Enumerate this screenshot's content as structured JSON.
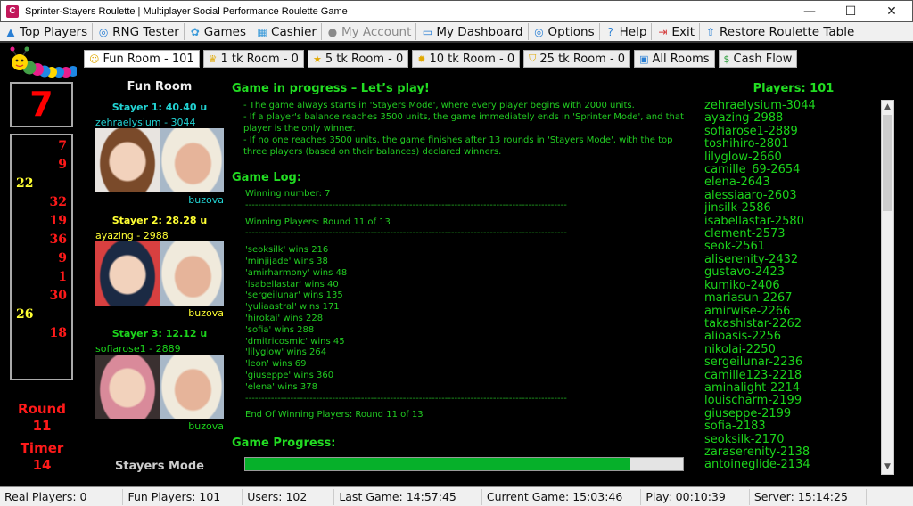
{
  "window": {
    "title": "Sprinter-Stayers Roulette | Multiplayer Social Performance Roulette Game",
    "app_icon_letter": "C",
    "controls": {
      "minimize": "—",
      "maximize": "☐",
      "close": "✕"
    }
  },
  "menu": [
    {
      "label": "Top Players",
      "icon": "podium-icon",
      "glyph": "▲",
      "color": "#2a7fd4",
      "disabled": false
    },
    {
      "label": "RNG Tester",
      "icon": "compass-icon",
      "glyph": "◎",
      "color": "#2a7fd4",
      "disabled": false
    },
    {
      "label": "Games",
      "icon": "gear-icon",
      "glyph": "✿",
      "color": "#3a9ad9",
      "disabled": false
    },
    {
      "label": "Cashier",
      "icon": "calculator-icon",
      "glyph": "▦",
      "color": "#3a9ad9",
      "disabled": false
    },
    {
      "label": "My Account",
      "icon": "user-icon",
      "glyph": "●",
      "color": "#8a8a8a",
      "disabled": true
    },
    {
      "label": "My Dashboard",
      "icon": "monitor-icon",
      "glyph": "▭",
      "color": "#2a7fd4",
      "disabled": false
    },
    {
      "label": "Options",
      "icon": "options-icon",
      "glyph": "◎",
      "color": "#2a7fd4",
      "disabled": false
    },
    {
      "label": "Help",
      "icon": "help-icon",
      "glyph": "?",
      "color": "#2a7fd4",
      "disabled": false
    },
    {
      "label": "Exit",
      "icon": "exit-icon",
      "glyph": "⇥",
      "color": "#d43a3a",
      "disabled": false
    },
    {
      "label": "Restore Roulette Table",
      "icon": "arrow-up-icon",
      "glyph": "⇧",
      "color": "#2a7fd4",
      "disabled": false
    }
  ],
  "rooms": [
    {
      "label": "Fun Room - 101",
      "icon": "smiley-icon",
      "glyph": "☺",
      "color": "#e0a800",
      "active": true
    },
    {
      "label": "1 tk Room - 0",
      "icon": "crown-icon",
      "glyph": "♛",
      "color": "#e0a800",
      "active": false
    },
    {
      "label": "5 tk Room - 0",
      "icon": "star-icon",
      "glyph": "★",
      "color": "#e0a800",
      "active": false
    },
    {
      "label": "10 tk Room - 0",
      "icon": "sun-icon",
      "glyph": "✹",
      "color": "#e0a800",
      "active": false
    },
    {
      "label": "25 tk Room - 0",
      "icon": "shield-icon",
      "glyph": "⛉",
      "color": "#e0a800",
      "active": false
    },
    {
      "label": "All Rooms",
      "icon": "tv-icon",
      "glyph": "▣",
      "color": "#2a7fd4",
      "active": false
    },
    {
      "label": "Cash Flow",
      "icon": "dollar-icon",
      "glyph": "$",
      "color": "#2e9e3e",
      "active": false
    }
  ],
  "winning_number": "7",
  "history": [
    {
      "n": "7",
      "color": "red"
    },
    {
      "n": "9",
      "color": "red"
    },
    {
      "n": "22",
      "color": "yellow"
    },
    {
      "n": "32",
      "color": "red"
    },
    {
      "n": "19",
      "color": "red"
    },
    {
      "n": "36",
      "color": "red"
    },
    {
      "n": "9",
      "color": "red"
    },
    {
      "n": "1",
      "color": "red"
    },
    {
      "n": "30",
      "color": "red"
    },
    {
      "n": "26",
      "color": "yellow"
    },
    {
      "n": "18",
      "color": "red"
    }
  ],
  "round": {
    "label": "Round",
    "value": "11"
  },
  "timer": {
    "label": "Timer",
    "value": "14"
  },
  "room_title": "Fun Room",
  "stayers": [
    {
      "title": "Stayer 1: 40.40 u",
      "player": "zehraelysium  -  3044",
      "partner": "buzova",
      "color": "cyan"
    },
    {
      "title": "Stayer 2: 28.28 u",
      "player": "ayazing  -  2988",
      "partner": "buzova",
      "color": "yellow"
    },
    {
      "title": "Stayer 3: 12.12 u",
      "player": "sofiarose1  -  2889",
      "partner": "buzova",
      "color": "green"
    }
  ],
  "mode_label": "Stayers Mode",
  "game": {
    "title": "Game in progress – Let’s play!",
    "rules": [
      "- The game always starts in 'Stayers Mode', where every player begins with 2000 units.",
      "- If a player's balance reaches 3500 units, the game immediately ends in 'Sprinter Mode', and that player is the only winner.",
      "- If no one reaches 3500 units, the game finishes after 13 rounds in 'Stayers Mode', with the top three players (based on their balances) declared winners."
    ]
  },
  "log": {
    "title": "Game Log:",
    "winning_number_line": "Winning number: 7",
    "separator": "----------------------------------------------------------------------------------------------------",
    "winning_header": "Winning Players: Round 11 of 13",
    "wins": [
      "'seoksilk' wins 216",
      "'minjijade' wins 38",
      "'amirharmony' wins 48",
      "'isabellastar' wins 40",
      "'sergeilunar' wins 135",
      "'yuliaastral' wins 171",
      "'hirokai' wins 228",
      "'sofia' wins 288",
      "'dmitricosmic' wins 45",
      "'lilyglow' wins 264",
      "'leon' wins 69",
      "'giuseppe' wins 360",
      "'elena' wins 378"
    ],
    "end_line": "End Of Winning Players: Round 11 of 13"
  },
  "progress": {
    "title": "Game Progress:",
    "percent": 88
  },
  "players": {
    "title": "Players: 101",
    "list": [
      "zehraelysium-3044",
      "ayazing-2988",
      "sofiarose1-2889",
      "toshihiro-2801",
      "lilyglow-2660",
      "camille_69-2654",
      "elena-2643",
      "alessiaaro-2603",
      "jinsilk-2586",
      "isabellastar-2580",
      "clement-2573",
      "seok-2561",
      "aliserenity-2432",
      "gustavo-2423",
      "kumiko-2406",
      "mariasun-2267",
      "amirwise-2266",
      "takashistar-2262",
      "alioasis-2256",
      "nikolai-2250",
      "sergeilunar-2236",
      "camille123-2218",
      "aminalight-2214",
      "louischarm-2199",
      "giuseppe-2199",
      "sofia-2183",
      "seoksilk-2170",
      "zaraserenity-2138",
      "antoineglide-2134"
    ]
  },
  "status": [
    {
      "label": "Real Players: 0"
    },
    {
      "label": "Fun Players: 101"
    },
    {
      "label": "Users: 102"
    },
    {
      "label": "Last Game: 14:57:45"
    },
    {
      "label": "Current Game: 15:03:46"
    },
    {
      "label": "Play: 00:10:39"
    },
    {
      "label": "Server: 15:14:25"
    }
  ]
}
